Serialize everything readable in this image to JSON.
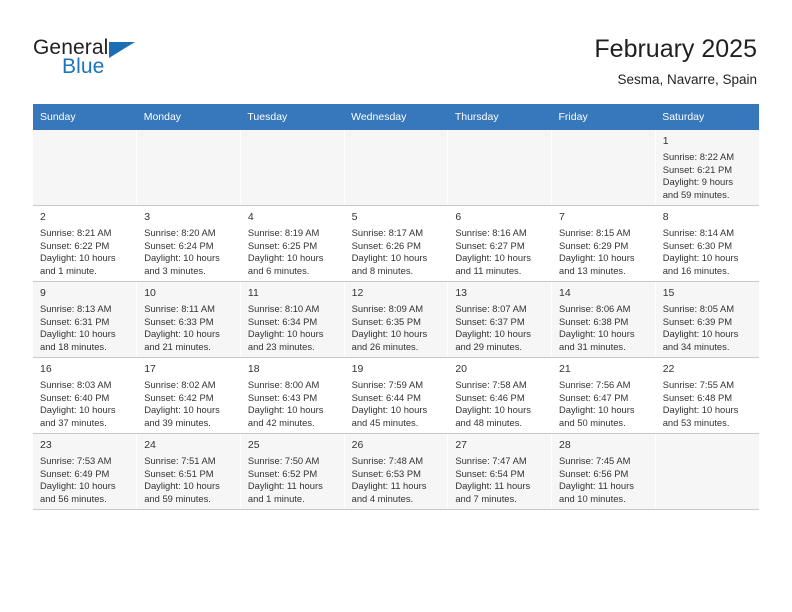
{
  "brand": {
    "general": "General",
    "blue": "Blue",
    "triangle_icon": "triangle-icon",
    "accent_color": "#1b75bb"
  },
  "header": {
    "title": "February 2025",
    "subtitle": "Sesma, Navarre, Spain"
  },
  "calendar": {
    "header_bg": "#3778bc",
    "weekdays": [
      "Sunday",
      "Monday",
      "Tuesday",
      "Wednesday",
      "Thursday",
      "Friday",
      "Saturday"
    ],
    "weeks": [
      [
        {
          "day": "",
          "lines": []
        },
        {
          "day": "",
          "lines": []
        },
        {
          "day": "",
          "lines": []
        },
        {
          "day": "",
          "lines": []
        },
        {
          "day": "",
          "lines": []
        },
        {
          "day": "",
          "lines": []
        },
        {
          "day": "1",
          "lines": [
            "Sunrise: 8:22 AM",
            "Sunset: 6:21 PM",
            "Daylight: 9 hours",
            "and 59 minutes."
          ]
        }
      ],
      [
        {
          "day": "2",
          "lines": [
            "Sunrise: 8:21 AM",
            "Sunset: 6:22 PM",
            "Daylight: 10 hours",
            "and 1 minute."
          ]
        },
        {
          "day": "3",
          "lines": [
            "Sunrise: 8:20 AM",
            "Sunset: 6:24 PM",
            "Daylight: 10 hours",
            "and 3 minutes."
          ]
        },
        {
          "day": "4",
          "lines": [
            "Sunrise: 8:19 AM",
            "Sunset: 6:25 PM",
            "Daylight: 10 hours",
            "and 6 minutes."
          ]
        },
        {
          "day": "5",
          "lines": [
            "Sunrise: 8:17 AM",
            "Sunset: 6:26 PM",
            "Daylight: 10 hours",
            "and 8 minutes."
          ]
        },
        {
          "day": "6",
          "lines": [
            "Sunrise: 8:16 AM",
            "Sunset: 6:27 PM",
            "Daylight: 10 hours",
            "and 11 minutes."
          ]
        },
        {
          "day": "7",
          "lines": [
            "Sunrise: 8:15 AM",
            "Sunset: 6:29 PM",
            "Daylight: 10 hours",
            "and 13 minutes."
          ]
        },
        {
          "day": "8",
          "lines": [
            "Sunrise: 8:14 AM",
            "Sunset: 6:30 PM",
            "Daylight: 10 hours",
            "and 16 minutes."
          ]
        }
      ],
      [
        {
          "day": "9",
          "lines": [
            "Sunrise: 8:13 AM",
            "Sunset: 6:31 PM",
            "Daylight: 10 hours",
            "and 18 minutes."
          ]
        },
        {
          "day": "10",
          "lines": [
            "Sunrise: 8:11 AM",
            "Sunset: 6:33 PM",
            "Daylight: 10 hours",
            "and 21 minutes."
          ]
        },
        {
          "day": "11",
          "lines": [
            "Sunrise: 8:10 AM",
            "Sunset: 6:34 PM",
            "Daylight: 10 hours",
            "and 23 minutes."
          ]
        },
        {
          "day": "12",
          "lines": [
            "Sunrise: 8:09 AM",
            "Sunset: 6:35 PM",
            "Daylight: 10 hours",
            "and 26 minutes."
          ]
        },
        {
          "day": "13",
          "lines": [
            "Sunrise: 8:07 AM",
            "Sunset: 6:37 PM",
            "Daylight: 10 hours",
            "and 29 minutes."
          ]
        },
        {
          "day": "14",
          "lines": [
            "Sunrise: 8:06 AM",
            "Sunset: 6:38 PM",
            "Daylight: 10 hours",
            "and 31 minutes."
          ]
        },
        {
          "day": "15",
          "lines": [
            "Sunrise: 8:05 AM",
            "Sunset: 6:39 PM",
            "Daylight: 10 hours",
            "and 34 minutes."
          ]
        }
      ],
      [
        {
          "day": "16",
          "lines": [
            "Sunrise: 8:03 AM",
            "Sunset: 6:40 PM",
            "Daylight: 10 hours",
            "and 37 minutes."
          ]
        },
        {
          "day": "17",
          "lines": [
            "Sunrise: 8:02 AM",
            "Sunset: 6:42 PM",
            "Daylight: 10 hours",
            "and 39 minutes."
          ]
        },
        {
          "day": "18",
          "lines": [
            "Sunrise: 8:00 AM",
            "Sunset: 6:43 PM",
            "Daylight: 10 hours",
            "and 42 minutes."
          ]
        },
        {
          "day": "19",
          "lines": [
            "Sunrise: 7:59 AM",
            "Sunset: 6:44 PM",
            "Daylight: 10 hours",
            "and 45 minutes."
          ]
        },
        {
          "day": "20",
          "lines": [
            "Sunrise: 7:58 AM",
            "Sunset: 6:46 PM",
            "Daylight: 10 hours",
            "and 48 minutes."
          ]
        },
        {
          "day": "21",
          "lines": [
            "Sunrise: 7:56 AM",
            "Sunset: 6:47 PM",
            "Daylight: 10 hours",
            "and 50 minutes."
          ]
        },
        {
          "day": "22",
          "lines": [
            "Sunrise: 7:55 AM",
            "Sunset: 6:48 PM",
            "Daylight: 10 hours",
            "and 53 minutes."
          ]
        }
      ],
      [
        {
          "day": "23",
          "lines": [
            "Sunrise: 7:53 AM",
            "Sunset: 6:49 PM",
            "Daylight: 10 hours",
            "and 56 minutes."
          ]
        },
        {
          "day": "24",
          "lines": [
            "Sunrise: 7:51 AM",
            "Sunset: 6:51 PM",
            "Daylight: 10 hours",
            "and 59 minutes."
          ]
        },
        {
          "day": "25",
          "lines": [
            "Sunrise: 7:50 AM",
            "Sunset: 6:52 PM",
            "Daylight: 11 hours",
            "and 1 minute."
          ]
        },
        {
          "day": "26",
          "lines": [
            "Sunrise: 7:48 AM",
            "Sunset: 6:53 PM",
            "Daylight: 11 hours",
            "and 4 minutes."
          ]
        },
        {
          "day": "27",
          "lines": [
            "Sunrise: 7:47 AM",
            "Sunset: 6:54 PM",
            "Daylight: 11 hours",
            "and 7 minutes."
          ]
        },
        {
          "day": "28",
          "lines": [
            "Sunrise: 7:45 AM",
            "Sunset: 6:56 PM",
            "Daylight: 11 hours",
            "and 10 minutes."
          ]
        },
        {
          "day": "",
          "lines": []
        }
      ]
    ]
  }
}
